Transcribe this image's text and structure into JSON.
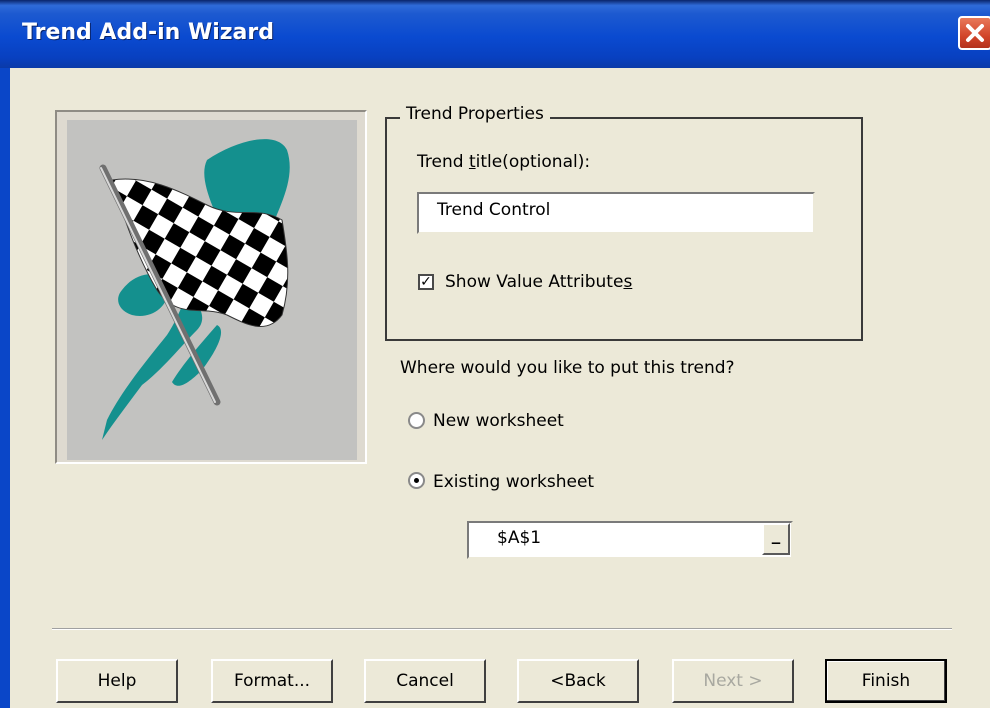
{
  "window": {
    "title": "Trend Add-in Wizard",
    "close_icon": "close-icon"
  },
  "image": {
    "icon": "checkered-flag-icon"
  },
  "trend_properties": {
    "group_label": "Trend Properties",
    "title_label_pre": "Trend ",
    "title_label_hotkey": "t",
    "title_label_post": "itle(optional):",
    "title_value": "Trend Control",
    "show_values_pre": "Show Value Attribute",
    "show_values_hotkey": "s",
    "show_values_checked": true
  },
  "placement": {
    "question": "Where would you like to put this trend?",
    "new_worksheet_label": "New worksheet",
    "existing_worksheet_label": "Existing worksheet",
    "selected": "existing",
    "reference_value": "$A$1",
    "reference_button_label": "_"
  },
  "buttons": {
    "help": "Help",
    "format": "Format...",
    "cancel": "Cancel",
    "back": "<Back",
    "next": "Next >",
    "finish": "Finish"
  },
  "colors": {
    "title_bar": "#0a4ad0",
    "dialog_bg": "#ece9d8",
    "teal_brush": "#14908e",
    "close_button": "#d2452a"
  }
}
